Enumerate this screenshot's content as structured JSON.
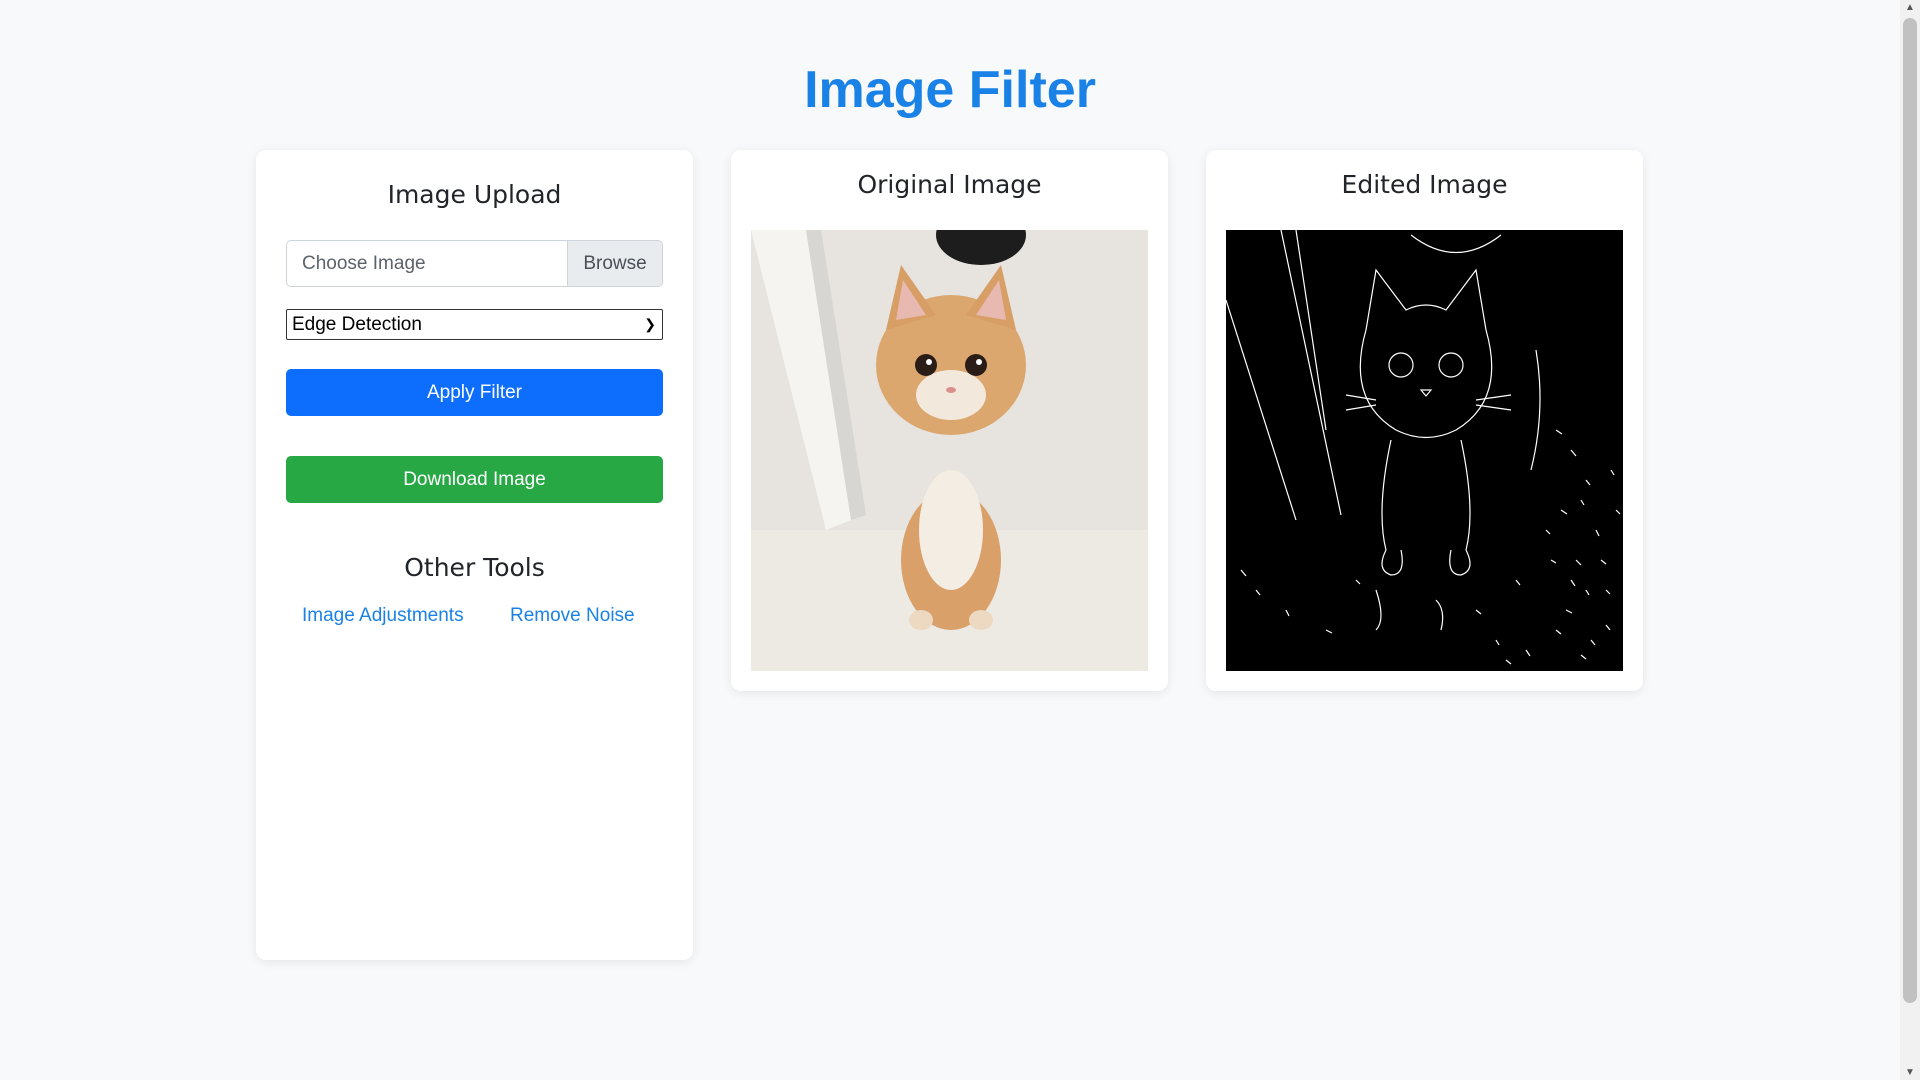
{
  "page": {
    "title": "Image Filter"
  },
  "upload": {
    "heading": "Image Upload",
    "file_placeholder": "Choose Image",
    "browse_label": "Browse",
    "filter_selected": "Edge Detection",
    "apply_label": "Apply Filter",
    "download_label": "Download Image",
    "tools_heading": "Other Tools",
    "tools": [
      "Image Adjustments",
      "Remove Noise"
    ]
  },
  "original": {
    "heading": "Original Image"
  },
  "edited": {
    "heading": "Edited Image"
  },
  "colors": {
    "title": "#1a82e6",
    "primary": "#0d6efd",
    "success": "#28a745",
    "link": "#1a82e6"
  }
}
